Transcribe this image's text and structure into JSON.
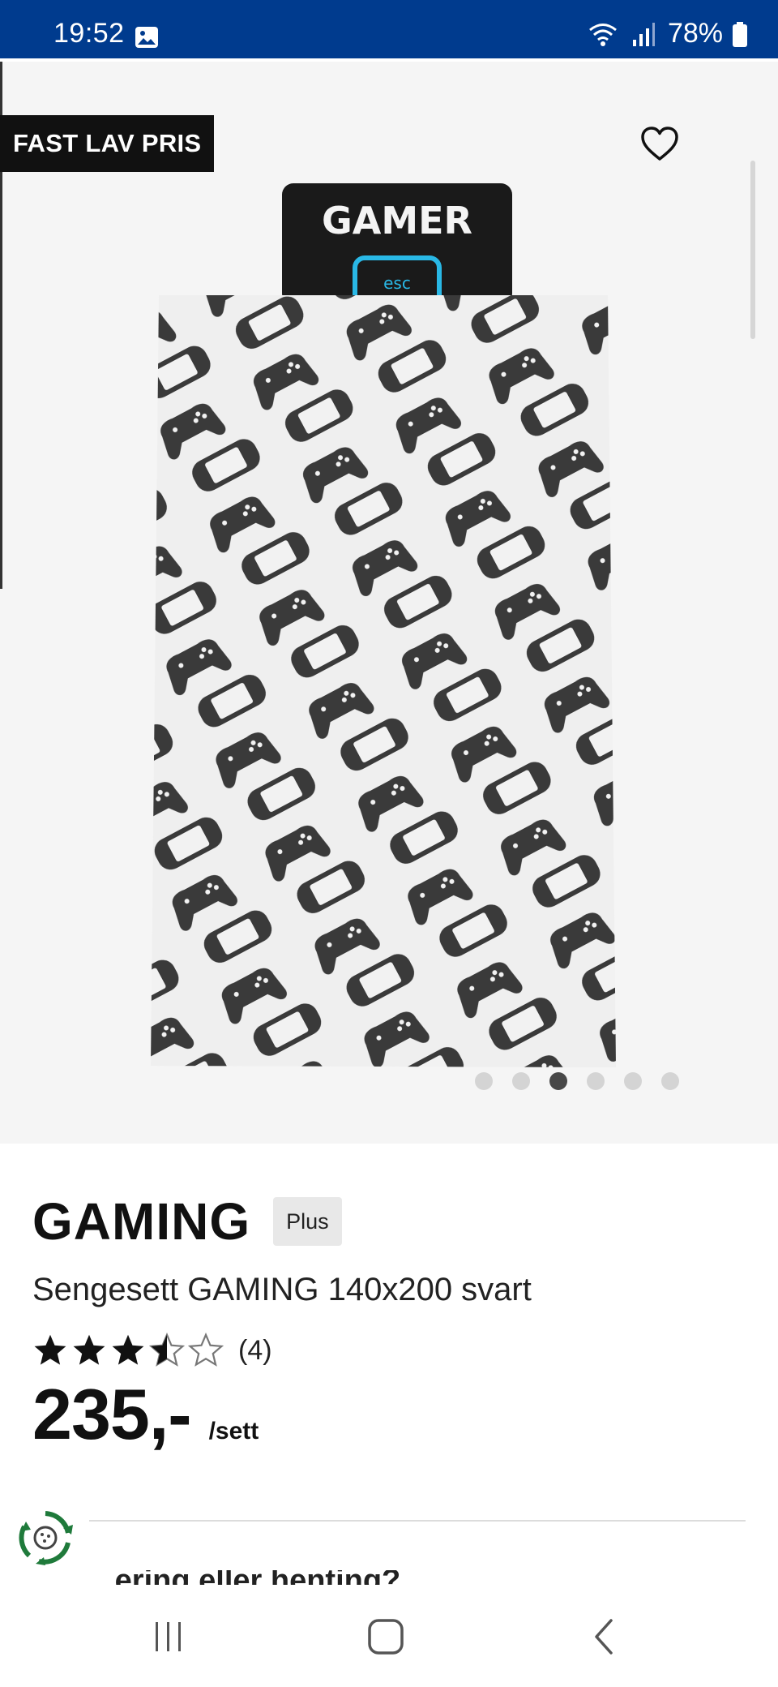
{
  "status_bar": {
    "time": "19:52",
    "battery": "78%",
    "icons": [
      "photo-icon",
      "wifi-icon",
      "signal-icon",
      "battery-icon"
    ],
    "background": "#003b8e"
  },
  "gallery": {
    "badge": "FAST LAV PRIS",
    "image_text": "GAMER",
    "image_key_label": "esc",
    "dots_total": 6,
    "active_dot": 3
  },
  "product": {
    "name": "GAMING",
    "tag": "Plus",
    "description": "Sengesett GAMING 140x200 svart",
    "rating": 3.5,
    "rating_max": 5,
    "rating_count": "(4)",
    "price": "235,-",
    "unit": "/sett"
  },
  "below": {
    "clipped_text": "...ering eller henting?"
  },
  "nav": {
    "icons": [
      "recent-apps-icon",
      "home-icon",
      "back-icon"
    ]
  }
}
